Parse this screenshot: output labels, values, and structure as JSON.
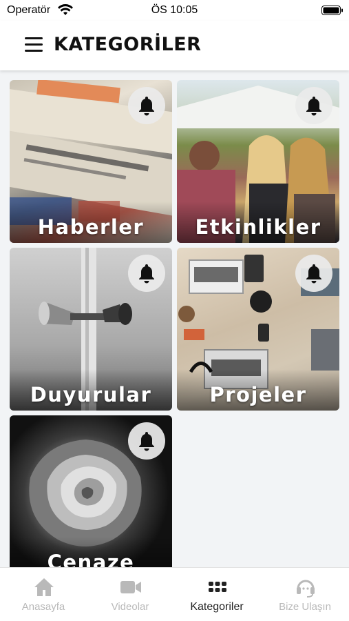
{
  "status_bar": {
    "carrier": "Operatör",
    "time": "ÖS 10:05"
  },
  "header": {
    "title": "KATEGORİLER"
  },
  "categories": [
    {
      "label": "Haberler"
    },
    {
      "label": "Etkinlikler"
    },
    {
      "label": "Duyurular"
    },
    {
      "label": "Projeler"
    },
    {
      "label": "Cenaze"
    }
  ],
  "tab_bar": {
    "items": [
      {
        "label": "Anasayfa",
        "icon": "home-icon",
        "active": false
      },
      {
        "label": "Videolar",
        "icon": "video-camera-icon",
        "active": false
      },
      {
        "label": "Kategoriler",
        "icon": "grid-dots-icon",
        "active": true
      },
      {
        "label": "Bize Ulaşın",
        "icon": "headset-icon",
        "active": false
      }
    ]
  },
  "colors": {
    "active_tab": "#222222",
    "inactive_tab": "#b9b9b9",
    "background": "#f2f4f6"
  }
}
